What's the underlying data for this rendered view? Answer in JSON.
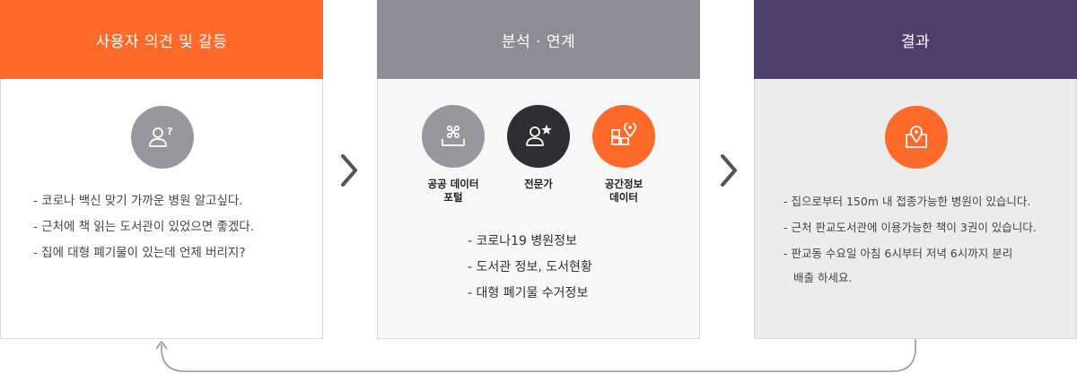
{
  "panels": [
    {
      "title": "사용자 의견 및 갈등",
      "icon": "user-question-icon",
      "lines": [
        "- 코로나 백신 맞기 가까운 병원 알고싶다.",
        "- 근처에 책 읽는 도서관이 있었으면 좋겠다.",
        "- 집에 대형 폐기물이 있는데 언제 버리지?"
      ]
    },
    {
      "title": "분석 · 연계",
      "icons": [
        {
          "icon": "data-portal-icon",
          "label_line1": "공공 데이터",
          "label_line2": "포털"
        },
        {
          "icon": "expert-icon",
          "label_line1": "전문가",
          "label_line2": ""
        },
        {
          "icon": "spatial-data-icon",
          "label_line1": "공간정보",
          "label_line2": "데이터"
        }
      ],
      "lines": [
        "-  코로나19 병원정보",
        "-  도서관 정보, 도서현황",
        "-  대형 폐기물 수거정보"
      ]
    },
    {
      "title": "결과",
      "icon": "map-location-icon",
      "lines": [
        "- 집으로부터 150m 내 접종가능한 병원이 있습니다.",
        "- 근처 판교도서관에 이용가능한 책이 3권이 있습니다.",
        "- 판교동 수요일 아침 6시부터 저녁 6시까지 분리",
        "배출 하세요."
      ]
    }
  ],
  "colors": {
    "orange": "#ff6a2b",
    "gray_head": "#8e8d96",
    "purple": "#4f3e6a",
    "icon_gray": "#98979e",
    "icon_dark": "#2e2e33"
  }
}
